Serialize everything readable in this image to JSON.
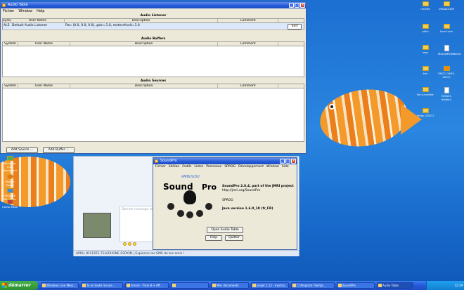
{
  "audio_table": {
    "title": "Audio Table",
    "menu": [
      "Fichier",
      "Window",
      "Help"
    ],
    "listener": {
      "title": "Audio Listener",
      "columns": [
        "Sysld",
        "User Name",
        "Description",
        "Comment"
      ],
      "row": [
        "ALS",
        "Default Audio Listener",
        "Pos: (0.0, 0.0, 0.0), gain=1.0, metersAsnit=1.0",
        ""
      ],
      "edit_label": "Edit"
    },
    "buffers": {
      "title": "Audio Buffers",
      "columns": [
        "System",
        "User Name",
        "Description",
        "Comment"
      ]
    },
    "sources": {
      "title": "Audio Sources",
      "columns": [
        "System",
        "User Name",
        "Description",
        "Comment"
      ]
    },
    "add_source_label": "Add Source ...",
    "add_buffer_label": "Add Buffer ..."
  },
  "soundpro": {
    "title": "SoundPro",
    "menu": [
      "Fichier",
      "Edition",
      "Outils",
      "Listes",
      "Panneaux",
      "SPROG",
      "Développement",
      "Window",
      "Aide"
    ],
    "logo_left": "Sound",
    "logo_right": "Pro",
    "logo_swirl": "AMBUUUU",
    "info_line1": "SoundPro 2.0.4, part of the JMRI project",
    "info_line2": "http://jmri.org/SoundPro",
    "info_line3": "SPROG",
    "info_line4": "Java version 1.6.0_18 (fr_FR)",
    "open_audio_table": "Open Audio Table",
    "help_label": "Help",
    "quitter_label": "Quitter"
  },
  "messenger": {
    "message_placeholder": "Dernier message reçu le ...",
    "banner": "APPLI OFFERTE TELEPHONE ESPION | Espionne les SMS de tes amis !"
  },
  "desktop_icons_right": [
    {
      "label": "recette"
    },
    {
      "label": "VRAIAOG69"
    },
    {
      "label": "albin"
    },
    {
      "label": "livre train"
    },
    {
      "label": "repo"
    },
    {
      "label": "Mezzo6f2d8be4d"
    },
    {
      "label": "tml"
    },
    {
      "label": "SNCF (1993-2007)"
    },
    {
      "label": "Ne surveiller"
    },
    {
      "label": "fichiers dialbau"
    },
    {
      "label": "Polos (2007)"
    }
  ],
  "desktop_icons_left": [
    {
      "label": "Windows Live Messenger"
    },
    {
      "label": "Mozilla Firefox"
    },
    {
      "label": "Sécurité Windows"
    },
    {
      "label": "Conso Ntop"
    }
  ],
  "taskbar": {
    "start_label": "démarrer",
    "tasks": [
      "Windows Live Mess...",
      "Tu es toute ma vie ...",
      "Forum - Train 8 + Aff...",
      "",
      "Mes documents",
      "projet 1.12 - myrhai...",
      "C:\\Program Files\\Ja...",
      "SoundPro",
      "Audio Table"
    ],
    "clock": "12:39"
  }
}
